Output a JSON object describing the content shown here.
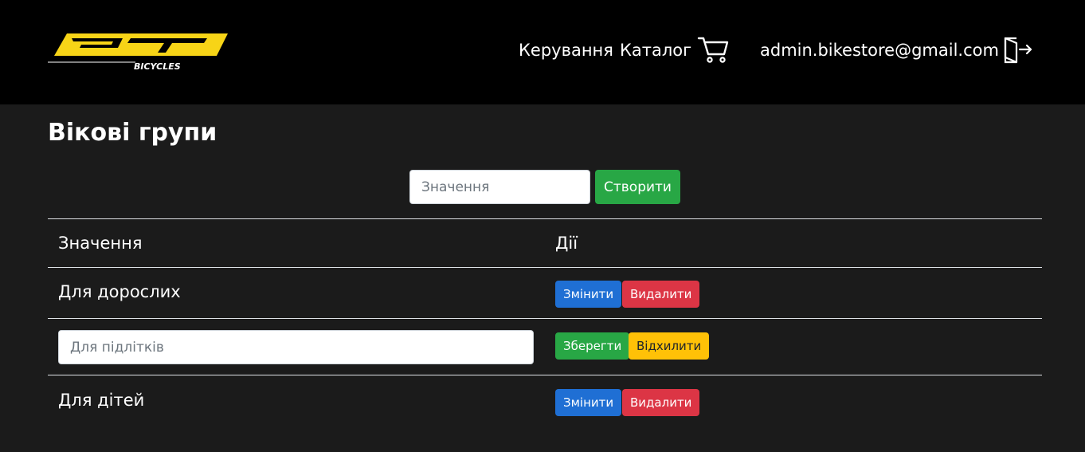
{
  "navbar": {
    "logo_text": "GT",
    "logo_subtext": "BICYCLES",
    "links": [
      "Керування",
      "Каталог"
    ],
    "icons": {
      "cart": "cart-icon",
      "logout": "logout-icon"
    },
    "user_email": "admin.bikestore@gmail.com"
  },
  "page": {
    "title": "Вікові групи"
  },
  "create_form": {
    "placeholder": "Значення",
    "value": "",
    "button_label": "Створити"
  },
  "table": {
    "headers": [
      "Значення",
      "Дії"
    ],
    "rows": [
      {
        "value": "Для дорослих",
        "mode": "view",
        "actions": [
          "Змінити",
          "Видалити"
        ]
      },
      {
        "value": "Для підлітків",
        "mode": "edit",
        "placeholder": "Для підлітків",
        "actions": [
          "Зберегти",
          "Відхилити"
        ]
      },
      {
        "value": "Для дітей",
        "mode": "view",
        "actions": [
          "Змінити",
          "Видалити"
        ]
      }
    ]
  },
  "colors": {
    "navbar_bg": "#000000",
    "page_bg": "#1b1b1b",
    "logo_yellow": "#f7d417",
    "primary": "#1f6fd4",
    "danger": "#dc3545",
    "success": "#28a745",
    "warning": "#ffc107"
  }
}
